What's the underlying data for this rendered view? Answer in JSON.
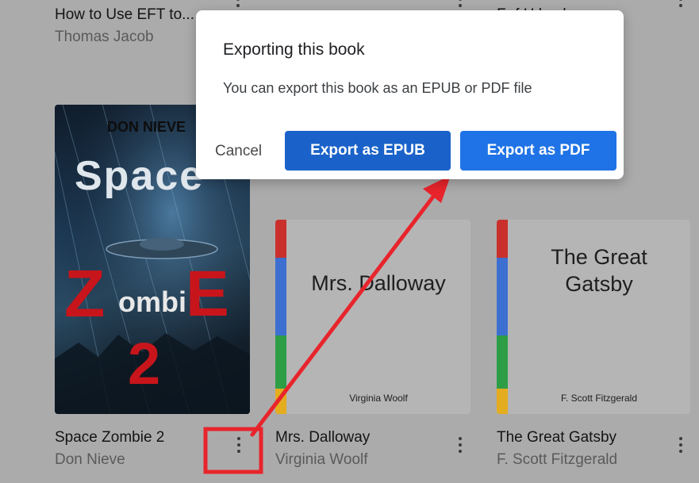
{
  "top_row": {
    "book1_title": "How to Use EFT to...",
    "book1_author": "Thomas Jacob",
    "book3_title": "Fr    f    H   l  eal..."
  },
  "books": [
    {
      "title": "Space Zombie 2",
      "author": "Don Nieve",
      "cover": {
        "author_line": "DON NIEVE",
        "word1": "Space",
        "word2a": "Z",
        "word2b": "ombi",
        "word2c": "E",
        "word3": "2"
      }
    },
    {
      "title": "Mrs. Dalloway",
      "author": "Virginia Woolf",
      "cover": {
        "title": "Mrs. Dalloway",
        "author": "Virginia Woolf"
      }
    },
    {
      "title": "The Great Gatsby",
      "author": "F. Scott Fitzgerald",
      "cover": {
        "title_line1": "The Great",
        "title_line2": "Gatsby",
        "author": "F. Scott Fitzgerald"
      }
    }
  ],
  "dialog": {
    "title": "Exporting this book",
    "message": "You can export this book as an EPUB or PDF file",
    "cancel_label": "Cancel",
    "epub_label": "Export as EPUB",
    "pdf_label": "Export as PDF"
  },
  "colors": {
    "annotation_red": "#e8242c",
    "epub_button": "#1a62c9",
    "pdf_button": "#1f73e6",
    "spine": [
      "#c9302c",
      "#3d6fd0",
      "#2e9e46",
      "#e4ac1f"
    ]
  },
  "icons": {
    "more_options": "more-vert-icon"
  }
}
